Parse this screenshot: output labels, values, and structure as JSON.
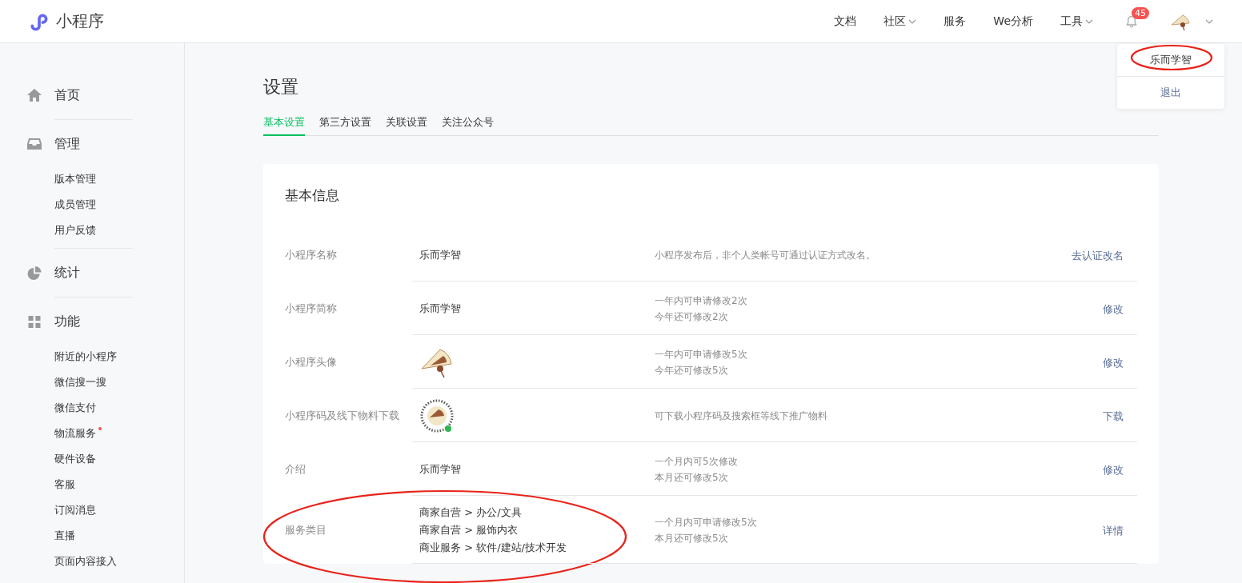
{
  "header": {
    "logo_text": "小程序",
    "nav": [
      {
        "label": "文档",
        "dropdown": false
      },
      {
        "label": "社区",
        "dropdown": true
      },
      {
        "label": "服务",
        "dropdown": false
      },
      {
        "label": "We分析",
        "dropdown": false
      },
      {
        "label": "工具",
        "dropdown": true
      }
    ],
    "notification_count": "45"
  },
  "account_menu": {
    "items": [
      {
        "label": "乐而学智",
        "kind": "name",
        "circled": true
      },
      {
        "label": "退出",
        "kind": "link",
        "circled": false
      }
    ]
  },
  "sidebar": {
    "groups": [
      {
        "title": "首页"
      },
      {
        "title": "管理",
        "items": [
          {
            "label": "版本管理",
            "dot": false
          },
          {
            "label": "成员管理",
            "dot": false
          },
          {
            "label": "用户反馈",
            "dot": false
          }
        ]
      },
      {
        "title": "统计"
      },
      {
        "title": "功能",
        "items": [
          {
            "label": "附近的小程序",
            "dot": false
          },
          {
            "label": "微信搜一搜",
            "dot": false
          },
          {
            "label": "微信支付",
            "dot": false
          },
          {
            "label": "物流服务",
            "dot": true
          },
          {
            "label": "硬件设备",
            "dot": false
          },
          {
            "label": "客服",
            "dot": false
          },
          {
            "label": "订阅消息",
            "dot": false
          },
          {
            "label": "直播",
            "dot": false
          },
          {
            "label": "页面内容接入",
            "dot": false
          }
        ]
      }
    ]
  },
  "page_title": "设置",
  "tabs": [
    {
      "label": "基本设置",
      "selected": true
    },
    {
      "label": "第三方设置",
      "selected": false
    },
    {
      "label": "关联设置",
      "selected": false
    },
    {
      "label": "关注公众号",
      "selected": false
    }
  ],
  "card": {
    "title": "基本信息",
    "rows": [
      {
        "label": "小程序名称",
        "kind": "text",
        "value": [
          "乐而学智"
        ],
        "notes": [
          "小程序发布后，非个人类帐号可通过认证方式改名。"
        ],
        "action": "去认证改名",
        "circled": false
      },
      {
        "label": "小程序简称",
        "kind": "text",
        "value": [
          "乐而学智"
        ],
        "notes": [
          "一年内可申请修改2次",
          "今年还可修改2次"
        ],
        "action": "修改",
        "circled": false
      },
      {
        "label": "小程序头像",
        "kind": "avatar",
        "value": [],
        "notes": [
          "一年内可申请修改5次",
          "今年还可修改5次"
        ],
        "action": "修改",
        "circled": false
      },
      {
        "label": "小程序码及线下物料下载",
        "kind": "qr",
        "value": [],
        "notes": [
          "可下载小程序码及搜索框等线下推广物料"
        ],
        "action": "下载",
        "circled": false
      },
      {
        "label": "介绍",
        "kind": "text",
        "value": [
          "乐而学智"
        ],
        "notes": [
          "一个月内可5次修改",
          "本月还可修改5次"
        ],
        "action": "修改",
        "circled": false
      },
      {
        "label": "服务类目",
        "kind": "text",
        "value": [
          "商家自营 > 办公/文具",
          "商家自营 > 服饰内衣",
          "商业服务 > 软件/建站/技术开发"
        ],
        "notes": [
          "一个月内可申请修改5次",
          "本月还可修改5次"
        ],
        "action": "详情",
        "circled": true
      }
    ]
  }
}
